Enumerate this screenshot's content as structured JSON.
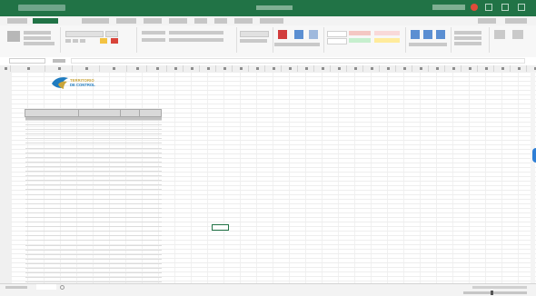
{
  "window": {
    "title": "",
    "accent": "#217346"
  },
  "logo": {
    "line1": "TERRITORIO",
    "line2": "DE CONTROL",
    "line3": ""
  },
  "sheet": {
    "heading": "",
    "headers": [
      "",
      "",
      "",
      ""
    ],
    "rows": [
      [
        "",
        "",
        "",
        ""
      ],
      [
        "",
        "",
        "",
        ""
      ],
      [
        "",
        "",
        "",
        ""
      ],
      [
        "",
        "",
        "",
        ""
      ],
      [
        "",
        "",
        "",
        ""
      ],
      [
        "",
        "",
        "",
        ""
      ],
      [
        "",
        "",
        "",
        ""
      ],
      [
        "",
        "",
        "",
        ""
      ],
      [
        "",
        "",
        "",
        ""
      ],
      [
        "",
        "",
        "",
        ""
      ],
      [
        "",
        "",
        "",
        ""
      ],
      [
        "",
        "",
        "",
        ""
      ],
      [
        "",
        "",
        "",
        ""
      ],
      [
        "",
        "",
        "",
        ""
      ],
      [
        "",
        "",
        "",
        ""
      ],
      [
        "",
        "",
        "",
        ""
      ],
      [
        "",
        "",
        "",
        ""
      ],
      [
        "",
        "",
        "",
        ""
      ],
      [
        "",
        "",
        "",
        ""
      ],
      [
        "",
        "",
        "",
        ""
      ],
      [
        "",
        "",
        "",
        ""
      ],
      [
        "",
        "",
        "",
        ""
      ],
      [
        "",
        "",
        "",
        ""
      ],
      [
        "",
        "",
        "",
        ""
      ],
      [
        "",
        "",
        "",
        ""
      ],
      [
        "",
        "",
        "",
        ""
      ],
      [
        "",
        "",
        "",
        ""
      ],
      [
        "",
        "",
        "",
        ""
      ],
      [
        "",
        "",
        "",
        ""
      ],
      [
        "",
        "",
        "",
        ""
      ],
      [
        "",
        "",
        "",
        ""
      ],
      [
        "",
        "",
        "",
        ""
      ],
      [
        "",
        "",
        "",
        ""
      ],
      [
        "",
        "",
        "",
        ""
      ],
      [
        "",
        "",
        "",
        ""
      ],
      [
        "",
        "",
        "",
        ""
      ],
      [
        "",
        "",
        "",
        ""
      ],
      [
        "",
        "",
        "",
        ""
      ],
      [
        "",
        "",
        "",
        ""
      ],
      [
        "",
        "",
        "",
        ""
      ],
      [
        "",
        "",
        "",
        ""
      ]
    ]
  },
  "icons": {
    "logo": "teardrop-logo-icon",
    "record": "record-icon",
    "add_sheet": "add-sheet-icon",
    "side_panel": "side-panel-bubble-icon"
  }
}
